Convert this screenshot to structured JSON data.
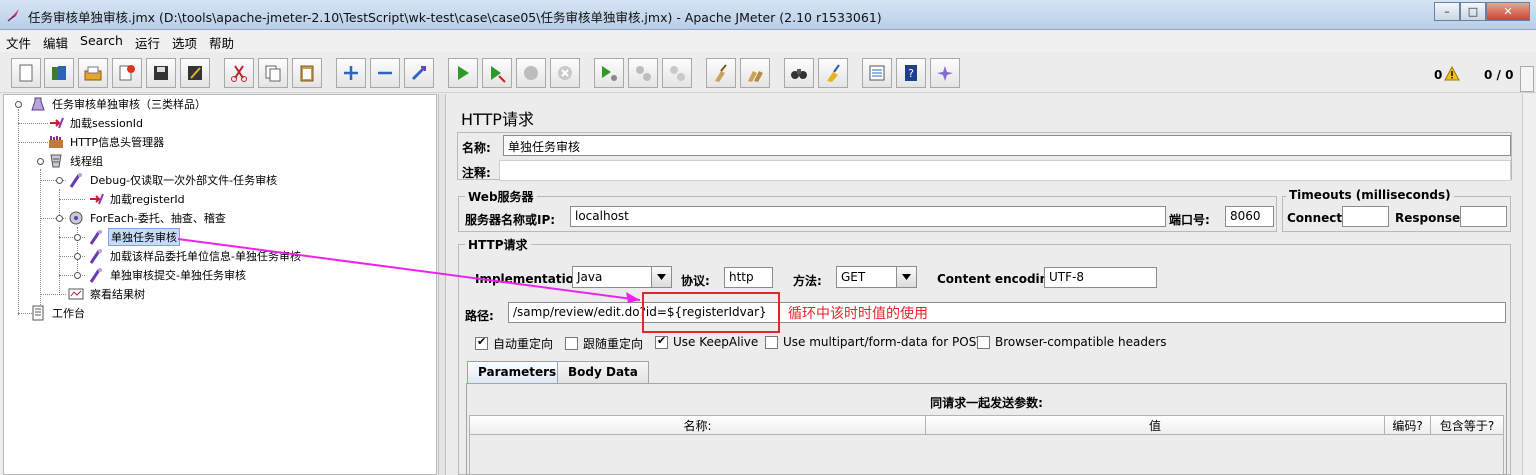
{
  "window": {
    "title": "任务审核单独审核.jmx (D:\\tools\\apache-jmeter-2.10\\TestScript\\wk-test\\case\\case05\\任务审核单独审核.jmx) - Apache JMeter (2.10 r1533061)",
    "min": "–",
    "max": "□",
    "close": "✕"
  },
  "menu": [
    "文件",
    "编辑",
    "Search",
    "运行",
    "选项",
    "帮助"
  ],
  "toolbar": {
    "icons": [
      "new-icon",
      "templates-icon",
      "open-icon",
      "close-file-icon",
      "save-icon",
      "save-as-icon",
      "cut-icon",
      "copy-icon",
      "paste-icon",
      "expand-icon",
      "collapse-icon",
      "toggle-icon",
      "start-icon",
      "start-no-pause-icon",
      "stop-icon",
      "shutdown-icon",
      "remote-start-icon",
      "remote-stop-icon",
      "remote-shutdown-icon",
      "clear-icon",
      "clear-all-icon",
      "search-icon",
      "reset-search-icon",
      "function-helper-icon",
      "help-icon",
      "log-viewer-icon"
    ],
    "warnings": "0",
    "threads": "0 / 0"
  },
  "tree": {
    "items": [
      {
        "label": "任务审核单独审核（三类样品）",
        "icon": "testplan-icon",
        "depth": 0
      },
      {
        "label": "加载sessionId",
        "icon": "preprocessor-icon",
        "depth": 1
      },
      {
        "label": "HTTP信息头管理器",
        "icon": "header-manager-icon",
        "depth": 1
      },
      {
        "label": "线程组",
        "icon": "thread-group-icon",
        "depth": 1
      },
      {
        "label": "Debug-仅读取一次外部文件-任务审核",
        "icon": "sampler-icon",
        "depth": 2
      },
      {
        "label": "加载registerId",
        "icon": "preprocessor-icon",
        "depth": 3
      },
      {
        "label": "ForEach-委托、抽查、稽查",
        "icon": "controller-icon",
        "depth": 2
      },
      {
        "label": "单独任务审核",
        "icon": "sampler-icon",
        "depth": 3,
        "selected": true
      },
      {
        "label": "加载该样品委托单位信息-单独任务审核",
        "icon": "sampler-icon",
        "depth": 3
      },
      {
        "label": "单独审核提交-单独任务审核",
        "icon": "sampler-icon",
        "depth": 3
      },
      {
        "label": "察看结果树",
        "icon": "listener-icon",
        "depth": 2
      },
      {
        "label": "工作台",
        "icon": "workbench-icon",
        "depth": 0
      }
    ]
  },
  "http": {
    "panel_title": "HTTP请求",
    "name_label": "名称:",
    "name_value": "单独任务审核",
    "comment_label": "注释:",
    "comment_value": "",
    "web_server_group": "Web服务器",
    "server_label": "服务器名称或IP:",
    "server_value": "localhost",
    "port_label": "端口号:",
    "port_value": "8060",
    "timeouts_group": "Timeouts (milliseconds)",
    "connect_label": "Connect:",
    "connect_value": "",
    "response_label": "Response:",
    "response_value": "",
    "request_group": "HTTP请求",
    "impl_label": "Implementation:",
    "impl_value": "Java",
    "protocol_label": "协议:",
    "protocol_value": "http",
    "method_label": "方法:",
    "method_value": "GET",
    "encoding_label": "Content encoding:",
    "encoding_value": "UTF-8",
    "path_label": "路径:",
    "path_value": "/samp/review/edit.do?id=${registerIdvar}",
    "checkboxes": [
      {
        "label": "自动重定向",
        "checked": true
      },
      {
        "label": "跟随重定向",
        "checked": false
      },
      {
        "label": "Use KeepAlive",
        "checked": true
      },
      {
        "label": "Use multipart/form-data for POST",
        "checked": false
      },
      {
        "label": "Browser-compatible headers",
        "checked": false
      }
    ],
    "tabs": [
      "Parameters",
      "Body Data"
    ],
    "params_title": "同请求一起发送参数:",
    "columns": [
      "名称:",
      "值",
      "编码?",
      "包含等于?"
    ]
  },
  "annotation": {
    "text": "循环中该时时值的使用",
    "color": "#e2262b",
    "arrow_color": "#ee22ee"
  }
}
